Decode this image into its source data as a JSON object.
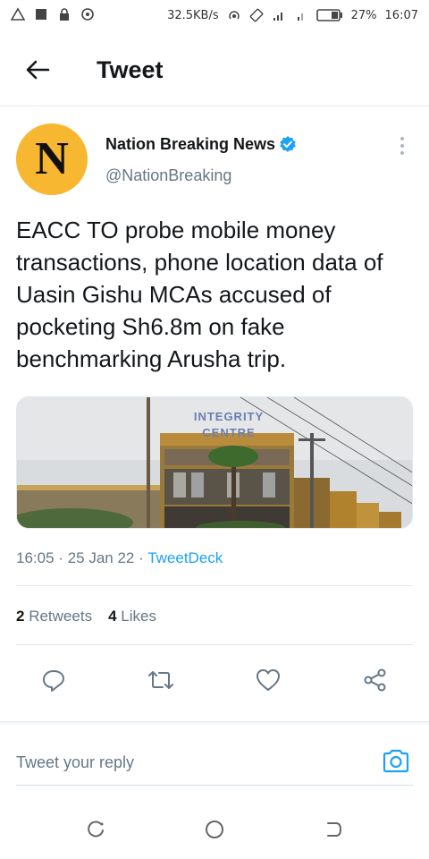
{
  "status_bar": {
    "net_speed": "32.5KB/s",
    "battery": "27%",
    "time": "16:07"
  },
  "header": {
    "title": "Tweet"
  },
  "tweet": {
    "author_name": "Nation Breaking News",
    "handle": "@NationBreaking",
    "avatar_letter": "N",
    "text": "EACC TO probe mobile money transactions, phone location data of Uasin Gishu MCAs accused of pocketing Sh6.8m on fake benchmarking Arusha trip.",
    "image_sign_line1": "INTEGRITY",
    "image_sign_line2": "CENTRE",
    "time": "16:05",
    "separator": "·",
    "date": "25 Jan 22",
    "source": "TweetDeck",
    "retweet_count": "2",
    "retweet_label": "Retweets",
    "like_count": "4",
    "like_label": "Likes"
  },
  "reply": {
    "placeholder": "Tweet your reply"
  },
  "colors": {
    "accent": "#1da1f2",
    "avatar_bg": "#f7b731",
    "secondary_text": "#657786"
  },
  "icons": {
    "back": "arrow-left-icon",
    "verified": "verified-badge-icon",
    "more": "more-vertical-icon",
    "reply": "reply-icon",
    "retweet": "retweet-icon",
    "like": "heart-icon",
    "share": "share-icon",
    "camera": "camera-icon"
  }
}
